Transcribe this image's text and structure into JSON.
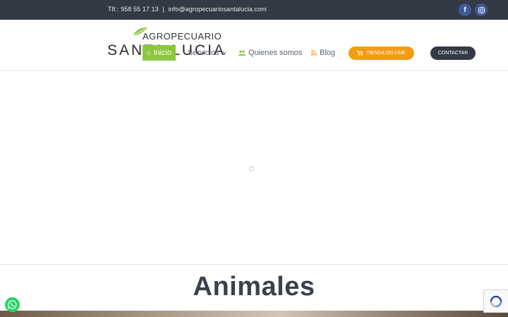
{
  "topbar": {
    "phone": "Tlf.: 958 55 17 13",
    "separator": "|",
    "email": "info@agropecuariosantalucia.com",
    "social": [
      {
        "icon": "facebook-icon",
        "glyph": "f"
      },
      {
        "icon": "instagram-icon"
      }
    ]
  },
  "logo": {
    "line1": "AGROPECUARIO",
    "line2": "SANTA LUCIA",
    "accent": "#8dc63f"
  },
  "nav": {
    "items": [
      {
        "label": "Inicio",
        "icon": "home-icon",
        "active": true
      },
      {
        "label": "Servicios",
        "icon": "chevron-down-icon",
        "caret": "∨"
      },
      {
        "label": "Quienes somos",
        "icon": "users-icon"
      },
      {
        "label": "Blog",
        "icon": "rss-icon"
      }
    ],
    "shop_button": {
      "label": "TIENDA ON-LINE",
      "icon": "cart-icon",
      "color": "#f39c12"
    },
    "contact_button": {
      "label": "CONTACTAR",
      "color": "#333a45"
    }
  },
  "section": {
    "title": "Animales"
  },
  "colors": {
    "topbar_bg": "#333a45",
    "accent_green": "#8dc63f",
    "accent_orange": "#f39c12",
    "title_color": "#3b414d"
  }
}
